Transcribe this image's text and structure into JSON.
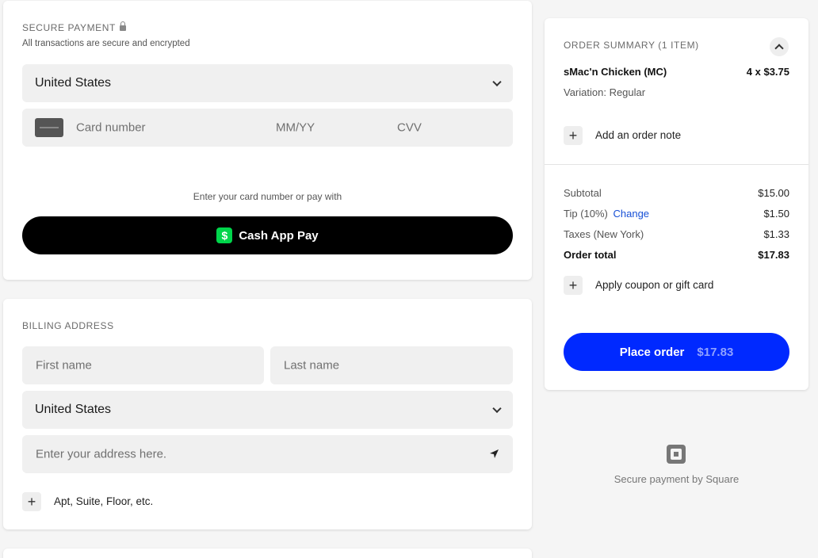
{
  "payment": {
    "title": "SECURE PAYMENT",
    "subtitle": "All transactions are secure and encrypted",
    "country": "United States",
    "card_number_placeholder": "Card number",
    "expiry_placeholder": "MM/YY",
    "cvv_placeholder": "CVV",
    "pay_with_text": "Enter your card number or pay with",
    "cash_app_label": "Cash App Pay",
    "cash_app_symbol": "$"
  },
  "billing": {
    "title": "BILLING ADDRESS",
    "first_name_placeholder": "First name",
    "last_name_placeholder": "Last name",
    "country": "United States",
    "address_placeholder": "Enter your address here.",
    "apt_label": "Apt, Suite, Floor, etc."
  },
  "summary": {
    "title": "ORDER SUMMARY (1 ITEM)",
    "item_name": "sMac'n Chicken (MC)",
    "item_qty_price": "4 x $3.75",
    "item_variation": "Variation: Regular",
    "order_note_label": "Add an order note",
    "subtotal_label": "Subtotal",
    "subtotal_value": "$15.00",
    "tip_label": "Tip (10%)",
    "tip_change": "Change",
    "tip_value": "$1.50",
    "taxes_label": "Taxes (New York)",
    "taxes_value": "$1.33",
    "total_label": "Order total",
    "total_value": "$17.83",
    "coupon_label": "Apply coupon or gift card",
    "place_order_label": "Place order",
    "place_order_amount": "$17.83"
  },
  "footer": {
    "secure_by": "Secure payment by Square"
  },
  "colors": {
    "accent_blue": "#0029ff",
    "cash_app_green": "#00d54b",
    "link_blue": "#1750d6"
  }
}
